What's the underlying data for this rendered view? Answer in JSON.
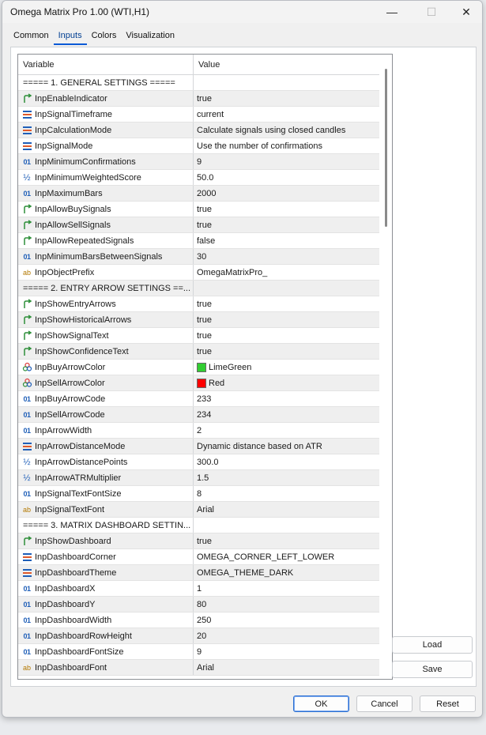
{
  "window": {
    "title": "Omega Matrix Pro 1.00 (WTI,H1)",
    "minimize_glyph": "—",
    "maximize_glyph": "☐",
    "close_glyph": "✕"
  },
  "tabs": [
    {
      "label": "Common",
      "active": false
    },
    {
      "label": "Inputs",
      "active": true
    },
    {
      "label": "Colors",
      "active": false
    },
    {
      "label": "Visualization",
      "active": false
    }
  ],
  "table": {
    "headers": {
      "variable": "Variable",
      "value": "Value"
    },
    "rows": [
      {
        "type": "section",
        "variable": "===== 1. GENERAL SETTINGS =====",
        "value": ""
      },
      {
        "type": "bool",
        "icon": "bool-arrow-icon",
        "variable": "InpEnableIndicator",
        "value": "true"
      },
      {
        "type": "enum",
        "icon": "enum-icon",
        "variable": "InpSignalTimeframe",
        "value": "current"
      },
      {
        "type": "enum",
        "icon": "enum-icon",
        "variable": "InpCalculationMode",
        "value": "Calculate signals using closed candles"
      },
      {
        "type": "enum",
        "icon": "enum-icon",
        "variable": "InpSignalMode",
        "value": "Use the number of confirmations"
      },
      {
        "type": "int",
        "icon": "int-icon",
        "variable": "InpMinimumConfirmations",
        "value": "9"
      },
      {
        "type": "double",
        "icon": "double-icon",
        "variable": "InpMinimumWeightedScore",
        "value": "50.0"
      },
      {
        "type": "int",
        "icon": "int-icon",
        "variable": "InpMaximumBars",
        "value": "2000"
      },
      {
        "type": "bool",
        "icon": "bool-arrow-icon",
        "variable": "InpAllowBuySignals",
        "value": "true"
      },
      {
        "type": "bool",
        "icon": "bool-arrow-icon",
        "variable": "InpAllowSellSignals",
        "value": "true"
      },
      {
        "type": "bool",
        "icon": "bool-arrow-icon",
        "variable": "InpAllowRepeatedSignals",
        "value": "false"
      },
      {
        "type": "int",
        "icon": "int-icon",
        "variable": "InpMinimumBarsBetweenSignals",
        "value": "30"
      },
      {
        "type": "string",
        "icon": "string-icon",
        "variable": "InpObjectPrefix",
        "value": "OmegaMatrixPro_"
      },
      {
        "type": "section",
        "variable": "===== 2. ENTRY ARROW SETTINGS ==...",
        "value": ""
      },
      {
        "type": "bool",
        "icon": "bool-arrow-icon",
        "variable": "InpShowEntryArrows",
        "value": "true"
      },
      {
        "type": "bool",
        "icon": "bool-arrow-icon",
        "variable": "InpShowHistoricalArrows",
        "value": "true"
      },
      {
        "type": "bool",
        "icon": "bool-arrow-icon",
        "variable": "InpShowSignalText",
        "value": "true"
      },
      {
        "type": "bool",
        "icon": "bool-arrow-icon",
        "variable": "InpShowConfidenceText",
        "value": "true"
      },
      {
        "type": "color",
        "icon": "color-icon",
        "variable": "InpBuyArrowColor",
        "value": "LimeGreen",
        "swatch": "#32cd32"
      },
      {
        "type": "color",
        "icon": "color-icon",
        "variable": "InpSellArrowColor",
        "value": "Red",
        "swatch": "#ff0000"
      },
      {
        "type": "int",
        "icon": "int-icon",
        "variable": "InpBuyArrowCode",
        "value": "233"
      },
      {
        "type": "int",
        "icon": "int-icon",
        "variable": "InpSellArrowCode",
        "value": "234"
      },
      {
        "type": "int",
        "icon": "int-icon",
        "variable": "InpArrowWidth",
        "value": "2"
      },
      {
        "type": "enum",
        "icon": "enum-icon",
        "variable": "InpArrowDistanceMode",
        "value": "Dynamic distance based on ATR"
      },
      {
        "type": "double",
        "icon": "double-icon",
        "variable": "InpArrowDistancePoints",
        "value": "300.0"
      },
      {
        "type": "double",
        "icon": "double-icon",
        "variable": "InpArrowATRMultiplier",
        "value": "1.5"
      },
      {
        "type": "int",
        "icon": "int-icon",
        "variable": "InpSignalTextFontSize",
        "value": "8"
      },
      {
        "type": "string",
        "icon": "string-icon",
        "variable": "InpSignalTextFont",
        "value": "Arial"
      },
      {
        "type": "section",
        "variable": "===== 3. MATRIX DASHBOARD SETTIN...",
        "value": ""
      },
      {
        "type": "bool",
        "icon": "bool-arrow-icon",
        "variable": "InpShowDashboard",
        "value": "true"
      },
      {
        "type": "enum",
        "icon": "enum-icon",
        "variable": "InpDashboardCorner",
        "value": "OMEGA_CORNER_LEFT_LOWER"
      },
      {
        "type": "enum",
        "icon": "enum-icon",
        "variable": "InpDashboardTheme",
        "value": "OMEGA_THEME_DARK"
      },
      {
        "type": "int",
        "icon": "int-icon",
        "variable": "InpDashboardX",
        "value": "1"
      },
      {
        "type": "int",
        "icon": "int-icon",
        "variable": "InpDashboardY",
        "value": "80"
      },
      {
        "type": "int",
        "icon": "int-icon",
        "variable": "InpDashboardWidth",
        "value": "250"
      },
      {
        "type": "int",
        "icon": "int-icon",
        "variable": "InpDashboardRowHeight",
        "value": "20"
      },
      {
        "type": "int",
        "icon": "int-icon",
        "variable": "InpDashboardFontSize",
        "value": "9"
      },
      {
        "type": "string",
        "icon": "string-icon",
        "variable": "InpDashboardFont",
        "value": "Arial"
      }
    ]
  },
  "side_buttons": {
    "load": "Load",
    "save": "Save"
  },
  "footer": {
    "ok": "OK",
    "cancel": "Cancel",
    "reset": "Reset"
  },
  "colors": {
    "accent": "#0a5ad6",
    "bool_icon": "#2f8f3a",
    "int_icon": "#1f5fb8",
    "string_icon": "#b37800"
  }
}
